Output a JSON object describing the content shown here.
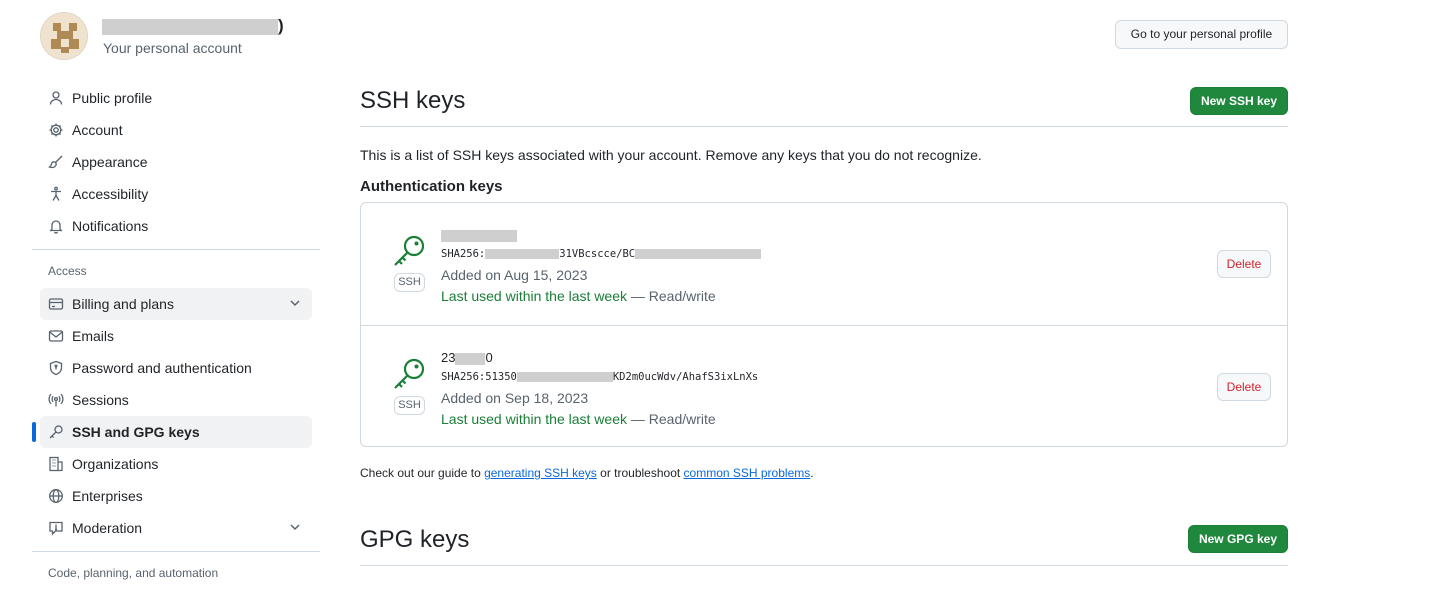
{
  "account": {
    "name_suffix": ")",
    "subtitle": "Your personal account",
    "profile_button": "Go to your personal profile"
  },
  "sidebar": {
    "group1": [
      {
        "label": "Public profile",
        "icon": "person-icon"
      },
      {
        "label": "Account",
        "icon": "gear-icon"
      },
      {
        "label": "Appearance",
        "icon": "paintbrush-icon"
      },
      {
        "label": "Accessibility",
        "icon": "accessibility-icon"
      },
      {
        "label": "Notifications",
        "icon": "bell-icon"
      }
    ],
    "access_heading": "Access",
    "group2": [
      {
        "label": "Billing and plans",
        "icon": "credit-card-icon"
      },
      {
        "label": "Emails",
        "icon": "mail-icon"
      },
      {
        "label": "Password and authentication",
        "icon": "shield-lock-icon"
      },
      {
        "label": "Sessions",
        "icon": "broadcast-icon"
      },
      {
        "label": "SSH and GPG keys",
        "icon": "key-icon"
      },
      {
        "label": "Organizations",
        "icon": "organization-icon"
      },
      {
        "label": "Enterprises",
        "icon": "globe-icon"
      },
      {
        "label": "Moderation",
        "icon": "report-icon"
      }
    ],
    "next_heading": "Code, planning, and automation"
  },
  "main": {
    "ssh_title": "SSH keys",
    "new_ssh_button": "New SSH key",
    "description": "This is a list of SSH keys associated with your account. Remove any keys that you do not recognize.",
    "auth_heading": "Authentication keys",
    "keys": [
      {
        "badge": "SSH",
        "title_visible": "",
        "fingerprint_prefix": "SHA256:",
        "fingerprint_fragment_1": "31VBcscce/BC",
        "fingerprint_suffix": "",
        "added": "Added on Aug 15, 2023",
        "usage_recent": "Last used within the last week",
        "usage_access": " — Read/write",
        "delete_label": "Delete"
      },
      {
        "badge": "SSH",
        "title_visible": "23",
        "title_suffix": "0",
        "fingerprint_prefix": "SHA256:51350",
        "fingerprint_fragment_1": "",
        "fingerprint_suffix": "KD2m0ucWdv/AhafS3ixLnXs",
        "added": "Added on Sep 18, 2023",
        "usage_recent": "Last used within the last week",
        "usage_access": " — Read/write",
        "delete_label": "Delete"
      }
    ],
    "guide": {
      "pre": "Check out our guide to ",
      "link1": "generating SSH keys",
      "mid": " or troubleshoot ",
      "link2": "common SSH problems",
      "post": "."
    },
    "gpg_title": "GPG keys",
    "new_gpg_button": "New GPG key"
  },
  "colors": {
    "green": "#1f883d",
    "link": "#0969da",
    "danger": "#d1242f",
    "active": "#0969da"
  }
}
